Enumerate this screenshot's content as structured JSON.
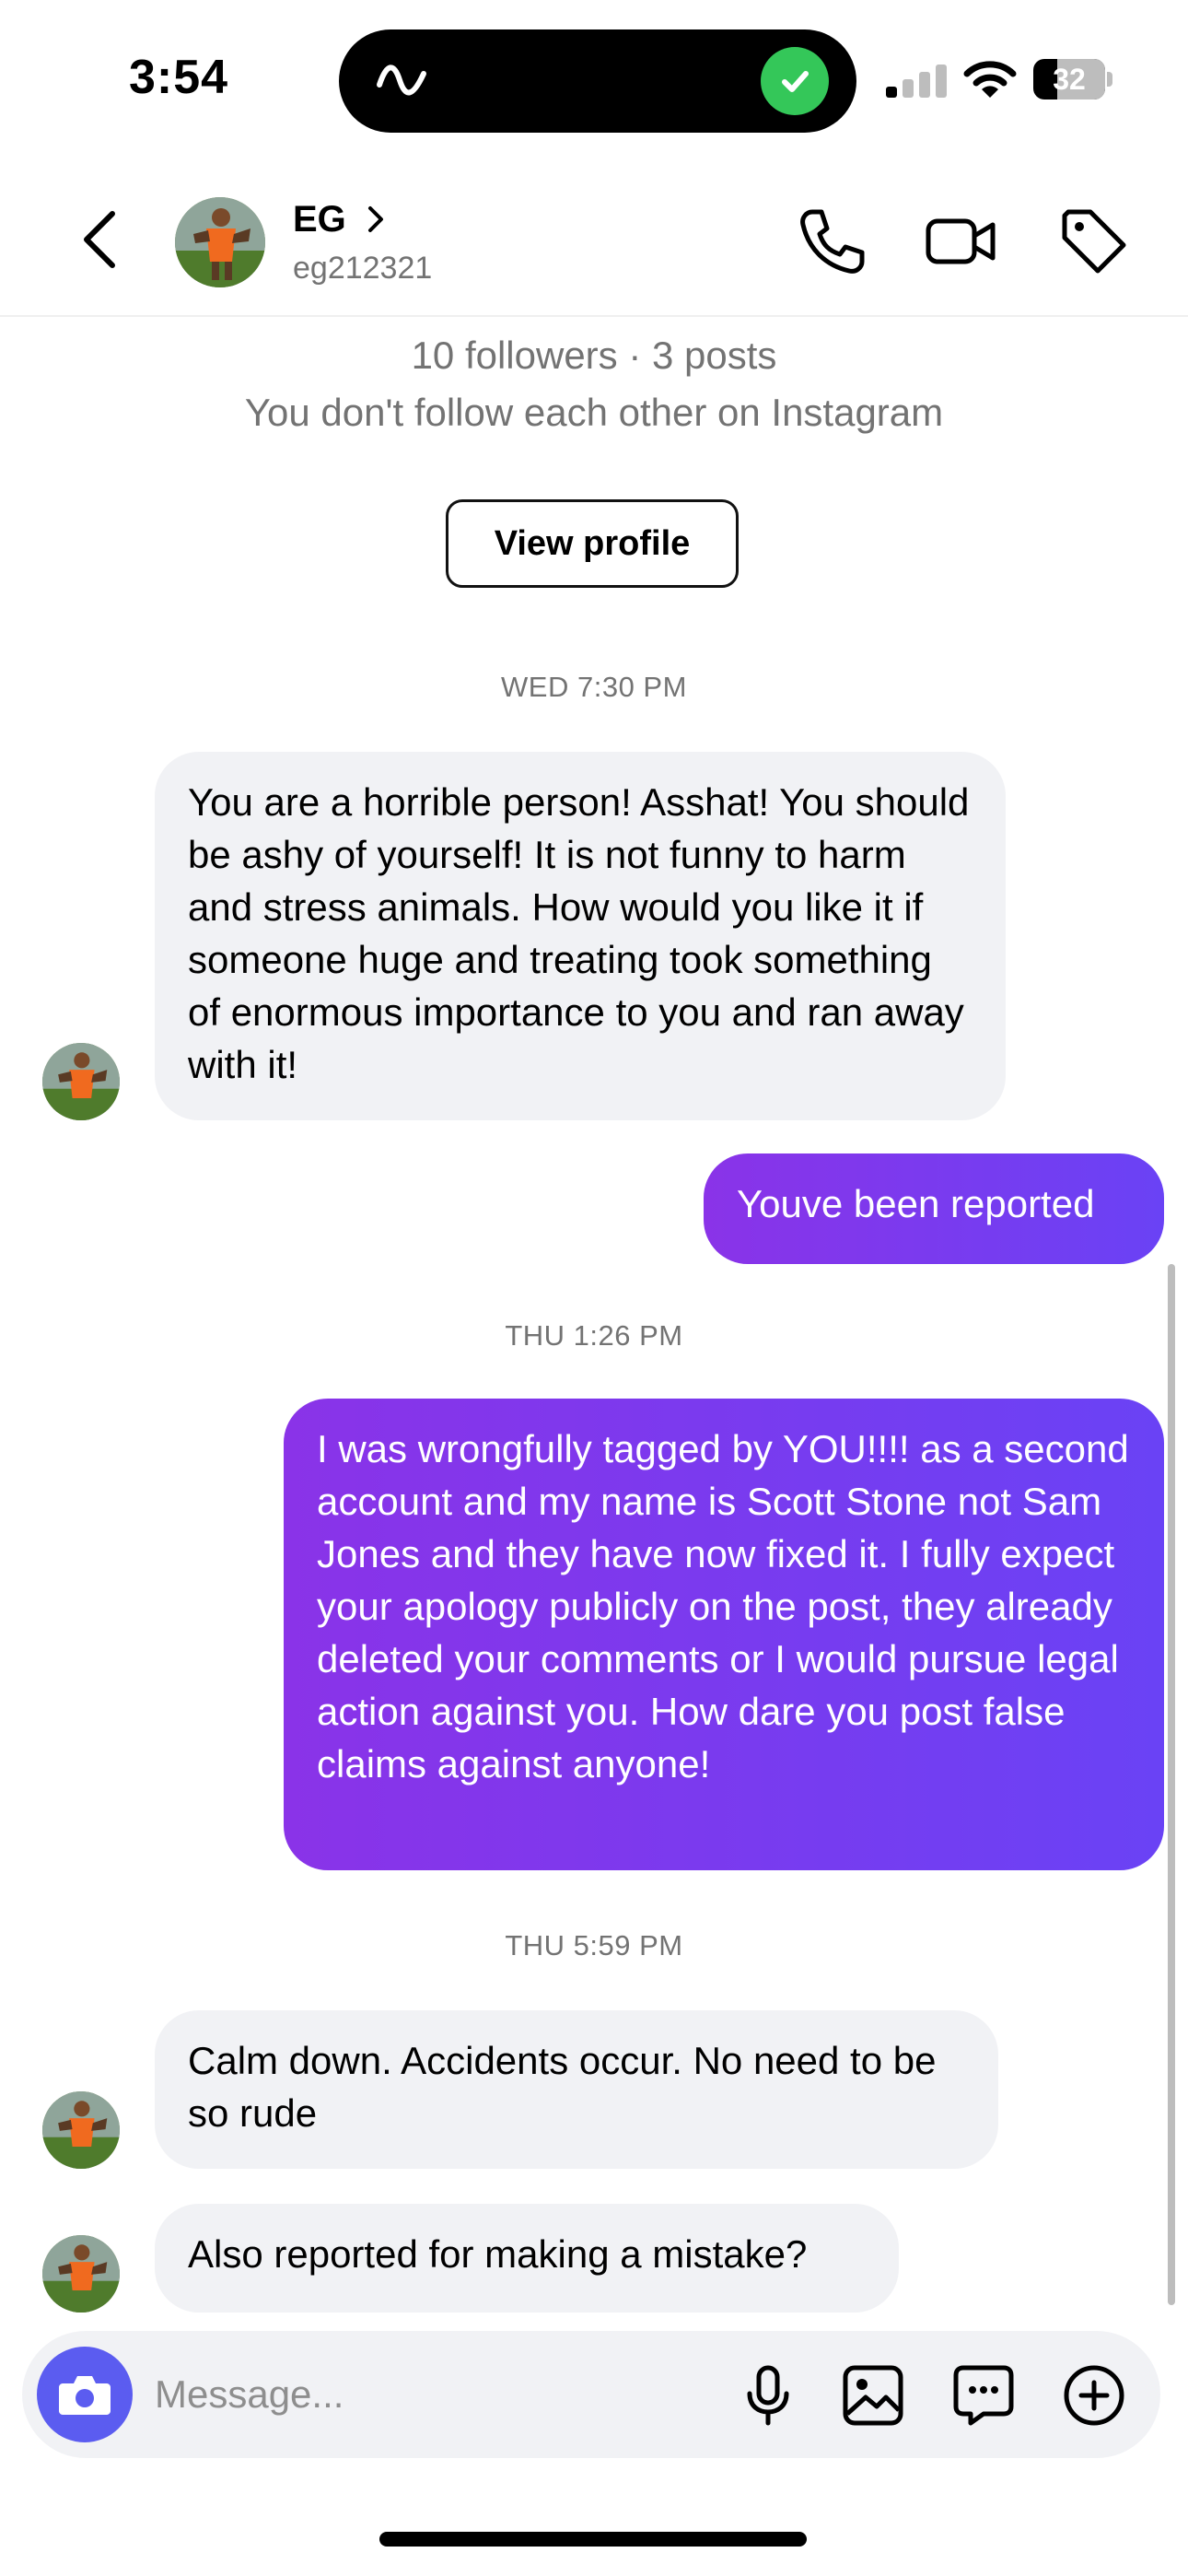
{
  "status_bar": {
    "time": "3:54",
    "battery": "32",
    "icons": [
      "activity-wave-icon",
      "check-icon",
      "cellular-signal-icon",
      "wifi-icon",
      "battery-icon"
    ]
  },
  "header": {
    "name": "EG",
    "username": "eg212321",
    "icons": [
      "chevron-left-icon",
      "chevron-right-icon",
      "phone-icon",
      "video-camera-icon",
      "tag-icon"
    ]
  },
  "profile": {
    "stats": "10 followers · 3 posts",
    "relationship": "You don't follow each other on Instagram",
    "view_profile_label": "View profile"
  },
  "timestamps": {
    "t1": "WED 7:30 PM",
    "t2": "THU 1:26 PM",
    "t3": "THU 5:59 PM"
  },
  "messages": [
    {
      "from": "them",
      "text": "You are a horrible person! Asshat! You should be ashy of yourself! It is not funny to harm and stress animals. How would you like it if someone huge and treating took something of enormous importance to you and ran away with it!"
    },
    {
      "from": "me",
      "text": "Youve been reported"
    },
    {
      "from": "me",
      "text": "I was wrongfully tagged by YOU!!!! as a second account and my name is Scott Stone not Sam Jones and they have now fixed it. I fully expect your apology publicly on the post, they already deleted your comments or I would pursue legal action against you. How dare you post false claims against anyone!"
    },
    {
      "from": "them",
      "text": "Calm down. Accidents occur. No need to be so rude"
    },
    {
      "from": "them",
      "text": "Also reported for making a mistake?"
    }
  ],
  "composer": {
    "placeholder": "Message...",
    "icons": [
      "camera-icon",
      "microphone-icon",
      "gallery-icon",
      "sticker-icon",
      "plus-circle-icon"
    ]
  },
  "colors": {
    "outgoing_start": "#8a33e8",
    "outgoing_end": "#6a42f5",
    "incoming_bg": "#f1f2f5",
    "camera_button": "#5b5cf0",
    "muted_text": "#737373"
  }
}
